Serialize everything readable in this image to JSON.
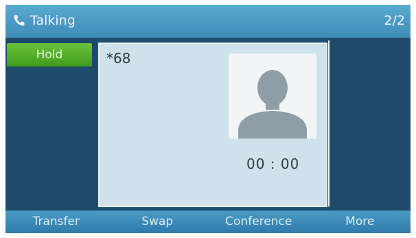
{
  "status_bar": {
    "title": "Talking",
    "call_count": "2/2",
    "icon": "phone-handset-icon"
  },
  "left_panel": {
    "hold_label": "Hold"
  },
  "call": {
    "dialed_number": "*68",
    "avatar_icon": "contact-silhouette-icon",
    "timer": "00 : 00"
  },
  "softkeys": [
    {
      "label": "Transfer"
    },
    {
      "label": "Swap"
    },
    {
      "label": "Conference"
    },
    {
      "label": "More"
    }
  ],
  "colors": {
    "status_bar": "#4a9bc7",
    "background": "#1f4f6e",
    "hold_button": "#57b02c",
    "call_card": "#cfe1ea"
  }
}
